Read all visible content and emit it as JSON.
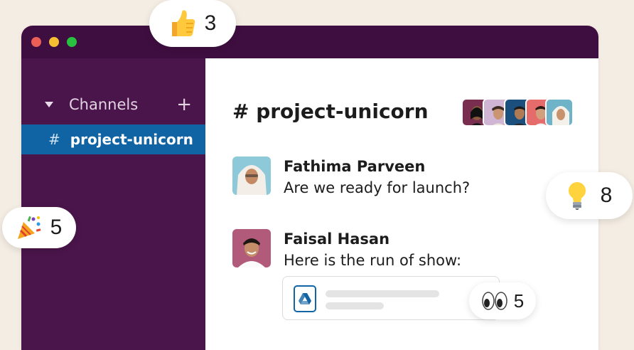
{
  "window": {
    "controls": [
      "close",
      "minimize",
      "zoom"
    ]
  },
  "sidebar": {
    "section_title": "Channels",
    "add_icon": "plus-icon",
    "active_channel": {
      "hash": "#",
      "name": "project-unicorn"
    }
  },
  "channel": {
    "title": "# project-unicorn",
    "member_count_avatars": 5
  },
  "messages": [
    {
      "sender": "Fathima Parveen",
      "text": "Are we ready for launch?"
    },
    {
      "sender": "Faisal Hasan",
      "text": "Here is the run of show:"
    }
  ],
  "attachment": {
    "icon": "google-drive-icon"
  },
  "reactions": {
    "thumbs_up": {
      "emoji": "thumbs-up",
      "count": "3"
    },
    "party": {
      "emoji": "party-popper",
      "count": "5"
    },
    "bulb": {
      "emoji": "light-bulb",
      "count": "8"
    },
    "eyes": {
      "emoji": "eyes",
      "count": "5"
    }
  },
  "colors": {
    "titlebar": "#3f0e40",
    "sidebar": "#4a154b",
    "active_channel": "#1164a3",
    "background": "#f4ede4"
  }
}
